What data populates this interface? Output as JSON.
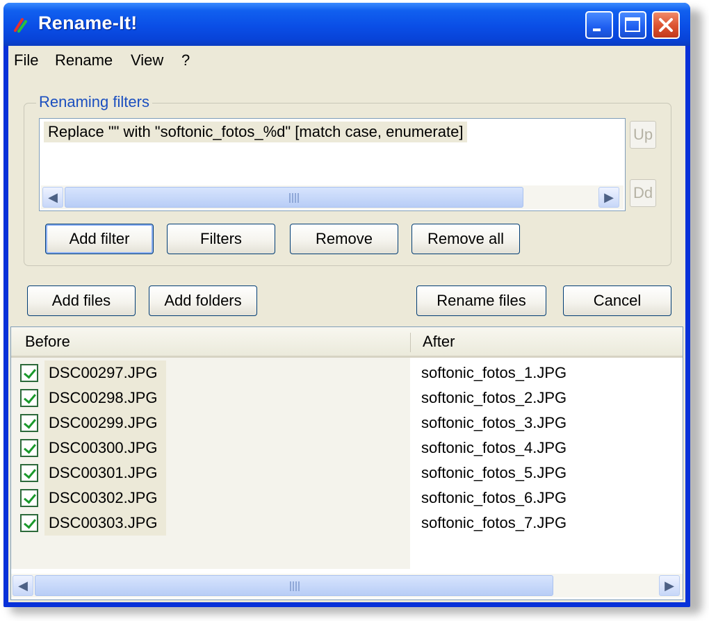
{
  "window": {
    "title": "Rename-It!"
  },
  "menu": [
    "File",
    "Rename",
    "View",
    "?"
  ],
  "filters": {
    "group_label": "Renaming filters",
    "items": [
      "Replace \"\" with \"softonic_fotos_%d\"  [match case, enumerate]"
    ],
    "up_label": "Up",
    "down_label": "Dd",
    "buttons": {
      "add_filter": "Add filter",
      "filters": "Filters",
      "remove": "Remove",
      "remove_all": "Remove all"
    }
  },
  "actions": {
    "add_files": "Add files",
    "add_folders": "Add folders",
    "rename_files": "Rename files",
    "cancel": "Cancel"
  },
  "file_list": {
    "columns": {
      "before": "Before",
      "after": "After"
    },
    "rows": [
      {
        "before": "DSC00297.JPG",
        "after": "softonic_fotos_1.JPG",
        "checked": true
      },
      {
        "before": "DSC00298.JPG",
        "after": "softonic_fotos_2.JPG",
        "checked": true
      },
      {
        "before": "DSC00299.JPG",
        "after": "softonic_fotos_3.JPG",
        "checked": true
      },
      {
        "before": "DSC00300.JPG",
        "after": "softonic_fotos_4.JPG",
        "checked": true
      },
      {
        "before": "DSC00301.JPG",
        "after": "softonic_fotos_5.JPG",
        "checked": true
      },
      {
        "before": "DSC00302.JPG",
        "after": "softonic_fotos_6.JPG",
        "checked": true
      },
      {
        "before": "DSC00303.JPG",
        "after": "softonic_fotos_7.JPG",
        "checked": true
      }
    ]
  },
  "colors": {
    "titlebar": "#0a4ee6",
    "window_bg": "#ece9d8",
    "group_label": "#1b4fbf",
    "close_button": "#dd5533"
  },
  "icons": {
    "app": "rename-it-app-icon",
    "minimize": "minimize-icon",
    "maximize": "maximize-icon",
    "close": "close-icon"
  }
}
